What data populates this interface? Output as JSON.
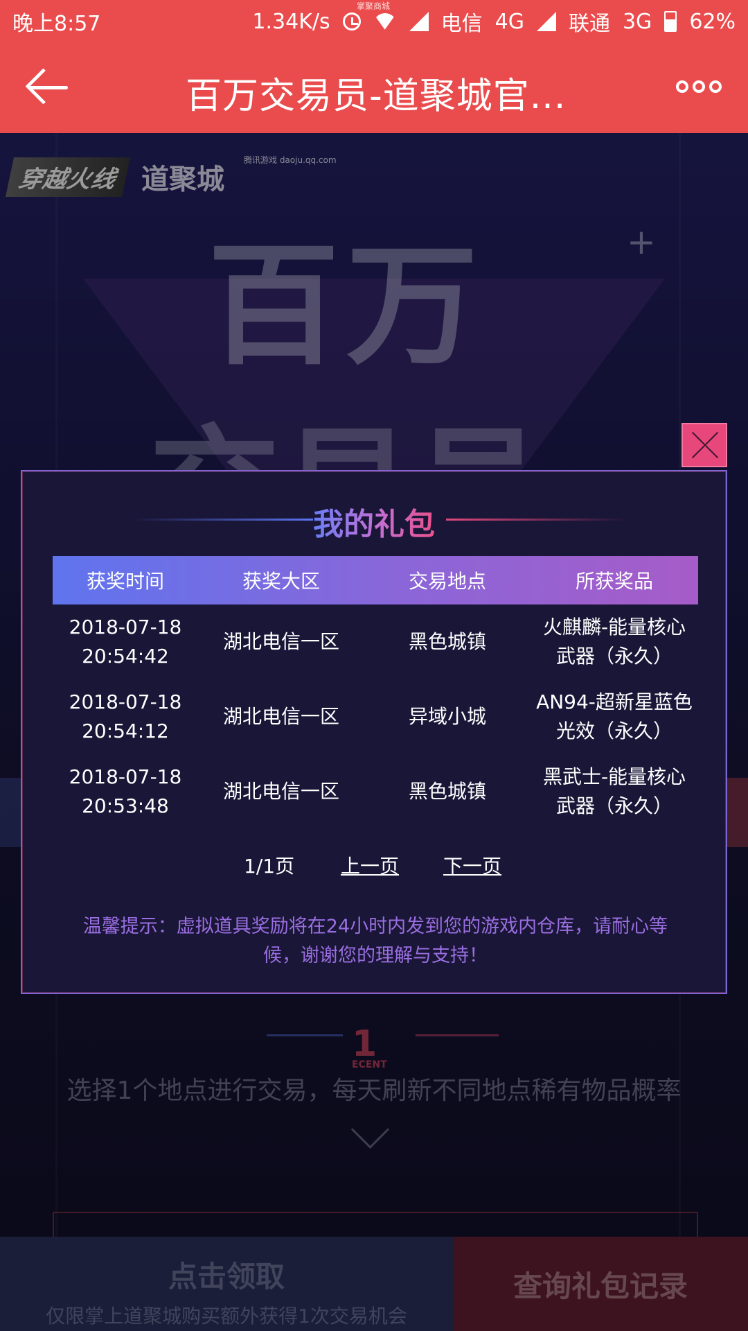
{
  "status_bar": {
    "time": "晚上8:57",
    "speed": "1.34K/s",
    "notification": "掌聚商城",
    "carrier1": "电信",
    "net1": "4G",
    "carrier2": "联通",
    "net2": "3G",
    "battery": "62%"
  },
  "app_bar": {
    "title": "百万交易员-道聚城官..."
  },
  "background": {
    "logo_cf": "穿越火线",
    "logo_daoju": "道聚城",
    "logo_daoju_sub": "腾讯游戏 daoju.qq.com",
    "hero_line1": "百万",
    "hero_line2": "交易员",
    "section_logo": "1",
    "section_logo_sub": "ECENT",
    "description": "选择1个地点进行交易，每天刷新不同地点稀有物品概率"
  },
  "bottom_bar": {
    "claim_title": "点击领取",
    "claim_subtitle": "仅限掌上道聚城购买额外获得1次交易机会",
    "records_button": "查询礼包记录"
  },
  "modal": {
    "title": "我的礼包",
    "columns": [
      "获奖时间",
      "获奖大区",
      "交易地点",
      "所获奖品"
    ],
    "rows": [
      {
        "date": "2018-07-18",
        "time": "20:54:42",
        "region": "湖北电信一区",
        "place": "黑色城镇",
        "prize_line1": "火麒麟-能量核心",
        "prize_line2": "武器（永久）"
      },
      {
        "date": "2018-07-18",
        "time": "20:54:12",
        "region": "湖北电信一区",
        "place": "异域小城",
        "prize_line1": "AN94-超新星蓝色",
        "prize_line2": "光效（永久）"
      },
      {
        "date": "2018-07-18",
        "time": "20:53:48",
        "region": "湖北电信一区",
        "place": "黑色城镇",
        "prize_line1": "黑武士-能量核心",
        "prize_line2": "武器（永久）"
      }
    ],
    "pager": {
      "page_info": "1/1页",
      "prev": "上一页",
      "next": "下一页"
    },
    "tip_line1": "温馨提示：虚拟道具奖励将在24小时内发到您的游戏内仓库，请耐心等",
    "tip_line2": "候，谢谢您的理解与支持！"
  },
  "colors": {
    "app_bar": "#ea4c4d",
    "modal_bg": "#191637",
    "header_gradient_start": "#5f74ee",
    "header_gradient_end": "#a65cc8",
    "tip_text": "#9a6ee0",
    "close_button": "#e7477a"
  }
}
